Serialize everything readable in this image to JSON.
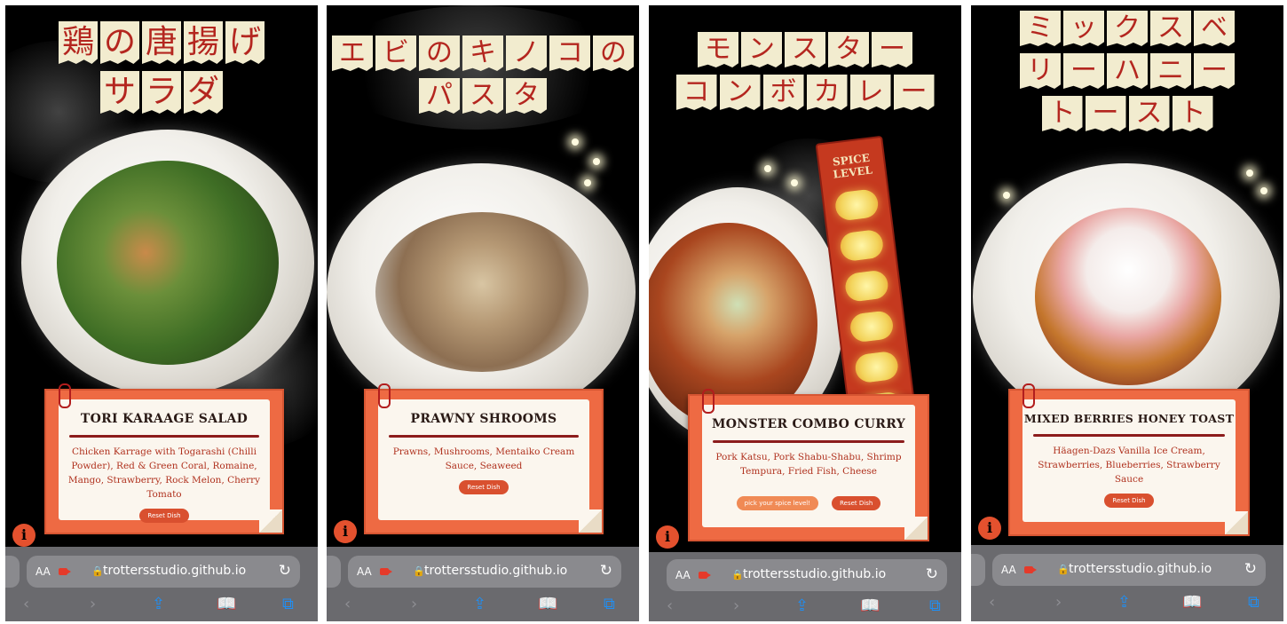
{
  "screens": [
    {
      "title_lines": [
        [
          "鶏",
          "の",
          "唐",
          "揚",
          "げ"
        ],
        [
          "サ",
          "ラ",
          "ダ"
        ]
      ],
      "dish_name": "TORI KARAAGE SALAD",
      "description": "Chicken Karrage with Togarashi (Chilli Powder), Red & Green Coral, Romaine, Mango, Strawberry, Rock Melon, Cherry Tomato",
      "reset_label": "Reset Dish",
      "info_label": "i"
    },
    {
      "title_lines": [
        [
          "エ",
          "ビ",
          "の",
          "キ",
          "ノ",
          "コ",
          "の"
        ],
        [
          "パ",
          "ス",
          "タ"
        ]
      ],
      "dish_name": "PRAWNY SHROOMS",
      "description": "Prawns, Mushrooms, Mentaiko Cream Sauce, Seaweed",
      "reset_label": "Reset Dish",
      "info_label": "i"
    },
    {
      "title_lines": [
        [
          "モ",
          "ン",
          "ス",
          "タ",
          "ー"
        ],
        [
          "コ",
          "ン",
          "ボ",
          "カ",
          "レ",
          "ー"
        ]
      ],
      "dish_name": "MONSTER COMBO CURRY",
      "description": "Pork Katsu, Pork Shabu-Shabu, Shrimp Tempura, Fried Fish, Cheese",
      "spice_button_label": "pick your spice level!",
      "spice_level_label": "SPICE LEVEL",
      "reset_label": "Reset Dish",
      "info_label": "i"
    },
    {
      "title_lines": [
        [
          "ミ",
          "ッ",
          "ク",
          "ス",
          "ベ"
        ],
        [
          "リ",
          "ー",
          "ハ",
          "ニ",
          "ー"
        ],
        [
          "ト",
          "ー",
          "ス",
          "ト"
        ]
      ],
      "dish_name": "MIXED BERRIES HONEY TOAST",
      "description": "Häagen-Dazs Vanilla Ice Cream, Strawberries, Blueberries, Strawberry Sauce",
      "reset_label": "Reset Dish",
      "info_label": "i"
    }
  ],
  "browser": {
    "aa_label": "AA",
    "url": "trottersstudio.github.io",
    "lock_icon": "🔒",
    "reload_icon": "↻",
    "back_icon": "‹",
    "forward_icon": "›",
    "share_icon": "⇪",
    "bookmarks_icon": "📖",
    "tabs_icon": "⧉",
    "accent_color": "#1f8ff5"
  }
}
